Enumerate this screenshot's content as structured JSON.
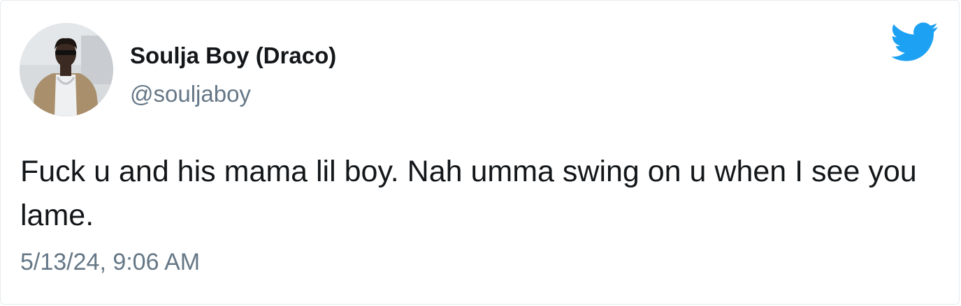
{
  "author": {
    "display_name": "Soulja Boy (Draco)",
    "handle": "@souljaboy"
  },
  "tweet": {
    "text": "Fuck u and his mama lil boy. Nah umma swing on u when I see you lame.",
    "timestamp": "5/13/24, 9:06 AM"
  },
  "icons": {
    "brand": "twitter-bird-icon",
    "avatar": "profile-photo"
  },
  "colors": {
    "brand_blue": "#1da1f2",
    "text_primary": "#14171a",
    "text_secondary": "#657786"
  }
}
